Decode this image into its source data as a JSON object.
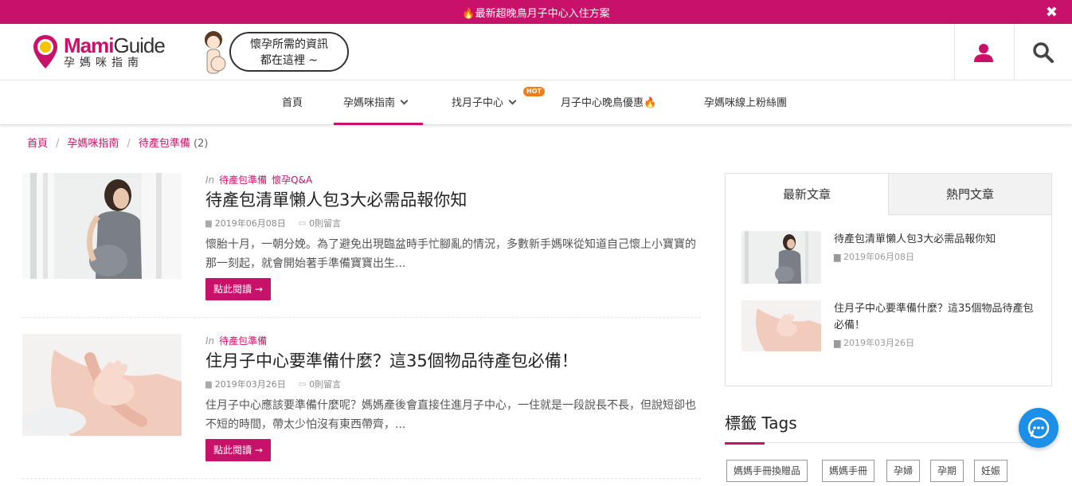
{
  "promo": {
    "text": "🔥最新超晚鳥月子中心入住方案",
    "close": "✖"
  },
  "header": {
    "logo_en_bold": "Mami",
    "logo_en_rest": "Guide",
    "logo_zh": "孕媽咪指南",
    "bubble_line1": "懷孕所需的資訊",
    "bubble_line2": "都在這裡 ~",
    "icons": {
      "user": "user-icon",
      "search": "search-icon"
    }
  },
  "nav": {
    "items": [
      {
        "label": "首頁"
      },
      {
        "label": "孕媽咪指南"
      },
      {
        "label": "找月子中心",
        "badge": "HOT"
      },
      {
        "label": "月子中心晚鳥優惠"
      },
      {
        "label": "孕媽咪線上粉絲團"
      }
    ],
    "flame": "🔥"
  },
  "breadcrumb": {
    "home": "首頁",
    "section": "孕媽咪指南",
    "current": "待產包準備",
    "count": "(2)"
  },
  "articles": [
    {
      "in": "In",
      "categories": [
        "待產包準備",
        "懷孕Q&A"
      ],
      "title": "待產包清單懶人包3大必需品報你知",
      "date": "2019年06月08日",
      "comments": "0則留言",
      "excerpt": "懷胎十月，一朝分娩。為了避免出現臨盆時手忙腳亂的情況，多數新手媽咪從知道自己懷上小寶寶的那一刻起，就會開始著手準備寶寶出生...",
      "button": "點此閱讀 →"
    },
    {
      "in": "In",
      "categories": [
        "待產包準備"
      ],
      "title": "住月子中心要準備什麼？這35個物品待產包必備！",
      "date": "2019年03月26日",
      "comments": "0則留言",
      "excerpt": "住月子中心應該要準備什麼呢？媽媽產後會直接住進月子中心，一住就是一段說長不長，但說短卻也不短的時間，帶太少怕沒有東西帶齊，...",
      "button": "點此閱讀 →"
    }
  ],
  "sidebar": {
    "tabs": [
      "最新文章",
      "熱門文章"
    ],
    "items": [
      {
        "title": "待產包清單懶人包3大必需品報你知",
        "date": "2019年06月08日"
      },
      {
        "title": "住月子中心要準備什麼？這35個物品待產包必備！",
        "date": "2019年03月26日"
      }
    ]
  },
  "tags": {
    "title": "標籤 Tags",
    "items": [
      "媽媽手冊換贈品",
      "媽媽手冊",
      "孕婦",
      "孕期",
      "妊娠"
    ]
  },
  "colors": {
    "brand": "#c8126a",
    "chat": "#1d8fe6",
    "hot": "#f07d1c"
  }
}
